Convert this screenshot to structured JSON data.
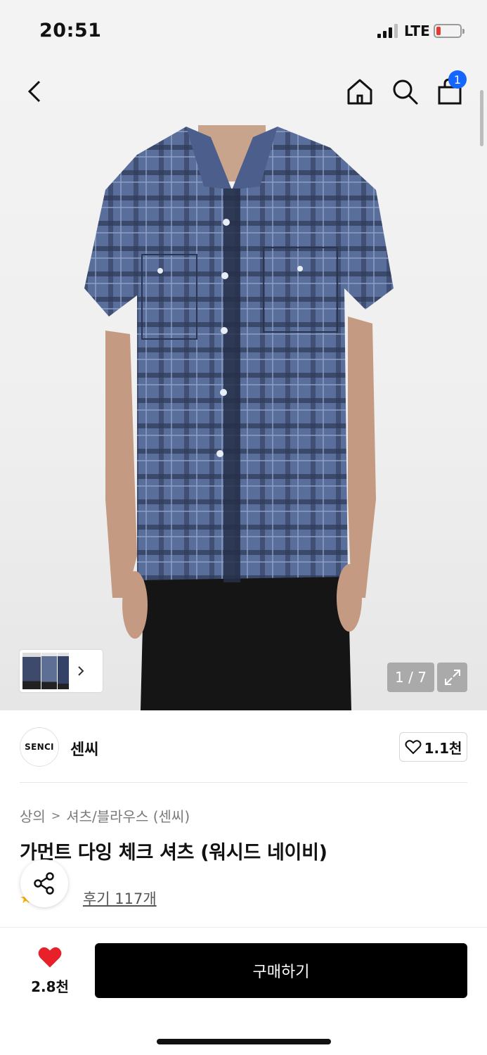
{
  "status_bar": {
    "time": "20:51",
    "network": "LTE",
    "battery_color": "#e53935"
  },
  "nav": {
    "back_icon": "chevron-left-icon",
    "home_icon": "home-icon",
    "search_icon": "search-icon",
    "cart_icon": "shopping-bag-icon",
    "cart_count": "1",
    "badge_color": "#1565ff"
  },
  "gallery": {
    "page_indicator": "1 / 7",
    "expand_icon": "expand-icon",
    "thumbs_more_icon": "chevron-right-icon"
  },
  "brand": {
    "logo_text": "SENCI",
    "name": "센씨",
    "likes": "1.1천"
  },
  "breadcrumb": {
    "category": "상의",
    "subcategory": "셔츠/블라우스 (센씨)"
  },
  "product": {
    "title": "가먼트 다잉 체크 셔츠 (워시드 네이비)",
    "reviews": "후기 117개"
  },
  "bottom": {
    "wish_count": "2.8천",
    "buy_label": "구매하기",
    "heart_color": "#e8202a"
  }
}
